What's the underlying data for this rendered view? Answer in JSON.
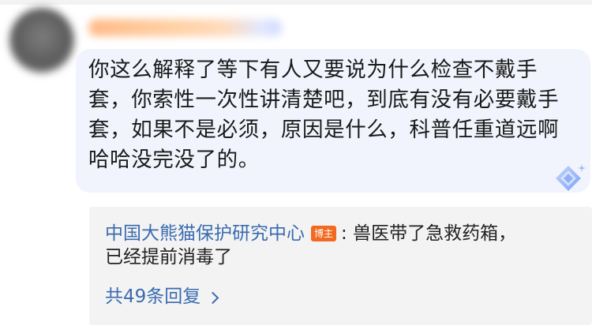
{
  "comment": {
    "text": "你这么解释了等下有人又要说为什么检查不戴手套，你索性一次性讲清楚吧，到底有没有必要戴手套，如果不是必须，原因是什么，科普任重道远啊哈哈没完没了的。"
  },
  "reply": {
    "author": "中国大熊猫保护研究中心",
    "author_badge": "博主",
    "separator": ":",
    "text_line1": "兽医带了急救药箱，",
    "text_line2": "已经提前消毒了"
  },
  "more_replies": {
    "label": "共49条回复"
  },
  "icons": {
    "top_comment_badge": "diamond-sparkle-icon",
    "chevron": "chevron-right-icon"
  },
  "colors": {
    "bubble_bg": "#f1f4fd",
    "link_blue": "#3a6bb0",
    "badge_orange": "#f26a21"
  }
}
